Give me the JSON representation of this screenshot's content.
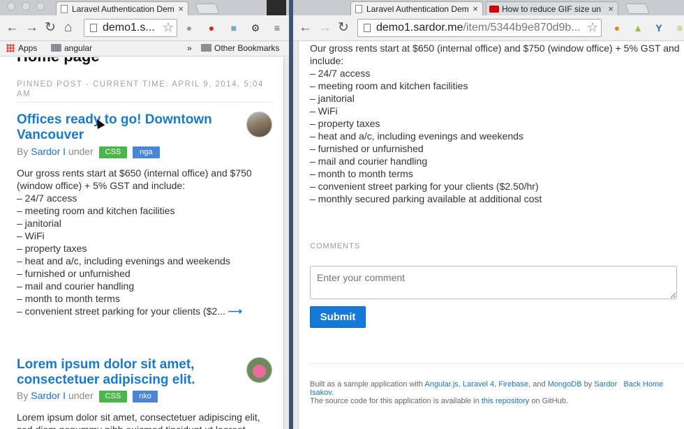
{
  "left_window": {
    "tab_title": "Laravel Authentication Dem",
    "address": {
      "domain": "demo1.s..."
    },
    "bookmarks": {
      "apps": "Apps",
      "folder1": "angular",
      "overflow": "»",
      "other": "Other Bookmarks"
    },
    "page": {
      "heading": "Home page",
      "pinned_label": "PINNED POST - CURRENT TIME: APRIL 9, 2014, 5:04 AM",
      "posts": [
        {
          "title": "Offices ready to go! Downtown Vancouver",
          "by_prefix": "By",
          "author": "Sardor I",
          "under": "under",
          "tags": [
            "CSS",
            "nga"
          ],
          "intro": "Our gross rents start at $650 (internal office) and $750 (window office) + 5% GST and include:",
          "items": [
            "– 24/7 access",
            "– meeting room and kitchen facilities",
            "– janitorial",
            "– WiFi",
            "– property taxes",
            "– heat and a/c, including evenings and weekends",
            "– furnished or unfurnished",
            "– mail and courier handling",
            "– month to month terms",
            "– convenient street parking for your clients ($2..."
          ],
          "more_arrow": "⟶"
        },
        {
          "title": "Lorem ipsum dolor sit amet, consectetuer adipiscing elit.",
          "by_prefix": "By",
          "author": "Sardor I",
          "under": "under",
          "tags": [
            "CSS",
            "nko"
          ],
          "intro": "Lorem ipsum dolor sit amet, consectetuer adipiscing elit, sed diam nonummy nibh euismod tincidunt ut laoreet"
        }
      ]
    }
  },
  "right_window": {
    "tabs": [
      {
        "title": "Laravel Authentication Dem",
        "close": "×"
      },
      {
        "title": "How to reduce GIF size un",
        "close": "×"
      }
    ],
    "address": {
      "domain": "demo1.sardor.me",
      "path": "/item/5344b9e870d9b..."
    },
    "page": {
      "intro": "Our gross rents start at $650 (internal office) and $750 (window office) + 5% GST and include:",
      "items": [
        "– 24/7 access",
        "– meeting room and kitchen facilities",
        "– janitorial",
        "– WiFi",
        "– property taxes",
        "– heat and a/c, including evenings and weekends",
        "– furnished or unfurnished",
        "– mail and courier handling",
        "– month to month terms",
        "– convenient street parking for your clients ($2.50/hr)",
        "– monthly secured parking available at additional cost"
      ],
      "comments_label": "COMMENTS",
      "comment_placeholder": "Enter your comment",
      "submit_label": "Submit",
      "footer": {
        "t1": "Built as a sample application with ",
        "l_angular": "Angular.js",
        "sep1": ", ",
        "l_laravel": "Laravel 4",
        "sep2": ", ",
        "l_firebase": "Firebase",
        "sep3": ", and ",
        "l_mongodb": "MongoDB",
        "t_by": " by ",
        "l_sardor": "Sardor",
        "l_back": "Back Home",
        "l_isakov": "Isakov",
        "t_dot": ".",
        "line2a": "The source code for this application is available in ",
        "l_repo": "this repository",
        "line2b": " on GitHub."
      }
    }
  },
  "colors": {
    "link": "#1a73c4",
    "tag_green": "#4cb64c",
    "tag_blue": "#4a86d8",
    "submit": "#1479d8",
    "desktop": "#3b5671"
  },
  "icons": [
    "page-icon",
    "back-arrow-icon",
    "forward-arrow-icon",
    "reload-icon",
    "home-icon",
    "star-icon",
    "extension-icon",
    "menu-icon",
    "folder-icon",
    "apps-grid-icon",
    "youtube-icon",
    "cursor-icon"
  ]
}
